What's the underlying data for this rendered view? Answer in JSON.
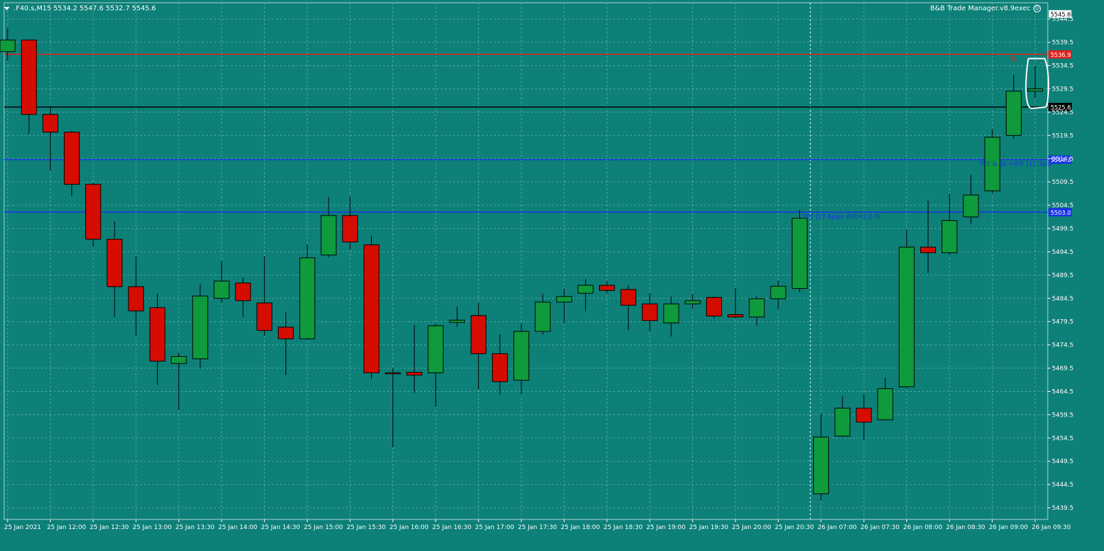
{
  "header": {
    "symbol_line": ".F40.s,M15  5534.2 5547.6 5532.7 5545.6",
    "expert_advisor": "B&B Trade Manager.v8.9exec"
  },
  "colors": {
    "background": "#0d8078",
    "bull": "#0f9a3c",
    "bear": "#d40d00",
    "grid": "#6fb8b2",
    "axis_text": "#ffffff",
    "sl_line": "#e0201c",
    "tp_line": "#1830e8",
    "price_line": "#000000"
  },
  "chart_data": {
    "type": "candlestick",
    "symbol": ".F40.s",
    "timeframe": "M15",
    "ylim": [
      5437.0,
      5548.0
    ],
    "y_ticks": [
      "5544.5",
      "5539.5",
      "5534.5",
      "5529.5",
      "5524.5",
      "5519.5",
      "5514.5",
      "5509.5",
      "5504.5",
      "5499.5",
      "5494.5",
      "5489.5",
      "5484.5",
      "5479.5",
      "5474.5",
      "5469.5",
      "5464.5",
      "5459.5",
      "5454.5",
      "5449.5",
      "5444.5",
      "5439.5"
    ],
    "x_labels": [
      "25 Jan 2021",
      "25 Jan 12:00",
      "25 Jan 12:30",
      "25 Jan 13:00",
      "25 Jan 13:30",
      "25 Jan 14:00",
      "25 Jan 14:30",
      "25 Jan 15:00",
      "25 Jan 15:30",
      "25 Jan 16:00",
      "25 Jan 16:30",
      "25 Jan 17:00",
      "25 Jan 17:30",
      "25 Jan 18:00",
      "25 Jan 18:30",
      "25 Jan 19:00",
      "25 Jan 19:30",
      "25 Jan 20:00",
      "25 Jan 20:30",
      "26 Jan 07:00",
      "26 Jan 07:30",
      "26 Jan 08:00",
      "26 Jan 08:30",
      "26 Jan 09:00",
      "26 Jan 09:30"
    ],
    "candles": [
      {
        "o": 5537.5,
        "h": 5542.6,
        "l": 5535.5,
        "c": 5540.0
      },
      {
        "o": 5540.0,
        "h": 5540.0,
        "l": 5519.8,
        "c": 5524.0
      },
      {
        "o": 5524.0,
        "h": 5525.8,
        "l": 5512.0,
        "c": 5520.2
      },
      {
        "o": 5520.2,
        "h": 5520.5,
        "l": 5506.5,
        "c": 5509.0
      },
      {
        "o": 5509.0,
        "h": 5509.3,
        "l": 5495.5,
        "c": 5497.2
      },
      {
        "o": 5497.2,
        "h": 5501.0,
        "l": 5480.5,
        "c": 5487.0
      },
      {
        "o": 5487.0,
        "h": 5493.5,
        "l": 5476.5,
        "c": 5481.8
      },
      {
        "o": 5482.5,
        "h": 5485.5,
        "l": 5466.0,
        "c": 5471.0
      },
      {
        "o": 5470.5,
        "h": 5472.8,
        "l": 5460.5,
        "c": 5472.0
      },
      {
        "o": 5471.5,
        "h": 5487.5,
        "l": 5469.5,
        "c": 5485.0
      },
      {
        "o": 5484.5,
        "h": 5492.5,
        "l": 5483.5,
        "c": 5488.2
      },
      {
        "o": 5487.8,
        "h": 5489.0,
        "l": 5480.5,
        "c": 5484.0
      },
      {
        "o": 5483.5,
        "h": 5493.5,
        "l": 5476.5,
        "c": 5477.6
      },
      {
        "o": 5478.3,
        "h": 5481.5,
        "l": 5468.0,
        "c": 5475.8
      },
      {
        "o": 5475.8,
        "h": 5496.0,
        "l": 5475.5,
        "c": 5493.2
      },
      {
        "o": 5493.8,
        "h": 5506.3,
        "l": 5493.3,
        "c": 5502.3
      },
      {
        "o": 5502.3,
        "h": 5506.3,
        "l": 5495.0,
        "c": 5496.6
      },
      {
        "o": 5496.0,
        "h": 5498.0,
        "l": 5467.3,
        "c": 5468.5
      },
      {
        "o": 5468.5,
        "h": 5469.5,
        "l": 5452.5,
        "c": 5468.3
      },
      {
        "o": 5468.6,
        "h": 5478.8,
        "l": 5464.2,
        "c": 5468.0
      },
      {
        "o": 5468.5,
        "h": 5479.0,
        "l": 5461.2,
        "c": 5478.6
      },
      {
        "o": 5479.3,
        "h": 5482.7,
        "l": 5478.4,
        "c": 5479.8
      },
      {
        "o": 5480.8,
        "h": 5483.5,
        "l": 5465.0,
        "c": 5472.6
      },
      {
        "o": 5472.6,
        "h": 5476.8,
        "l": 5463.8,
        "c": 5466.6
      },
      {
        "o": 5466.9,
        "h": 5479.0,
        "l": 5463.8,
        "c": 5477.4
      },
      {
        "o": 5477.4,
        "h": 5485.5,
        "l": 5476.7,
        "c": 5483.7
      },
      {
        "o": 5483.7,
        "h": 5486.6,
        "l": 5479.2,
        "c": 5484.9
      },
      {
        "o": 5485.6,
        "h": 5488.6,
        "l": 5481.7,
        "c": 5487.3
      },
      {
        "o": 5487.3,
        "h": 5488.2,
        "l": 5485.6,
        "c": 5486.2
      },
      {
        "o": 5486.4,
        "h": 5487.4,
        "l": 5477.7,
        "c": 5483.0
      },
      {
        "o": 5483.3,
        "h": 5485.6,
        "l": 5477.5,
        "c": 5479.7
      },
      {
        "o": 5479.2,
        "h": 5484.9,
        "l": 5476.3,
        "c": 5483.3
      },
      {
        "o": 5483.3,
        "h": 5485.4,
        "l": 5482.3,
        "c": 5484.0
      },
      {
        "o": 5484.7,
        "h": 5485.0,
        "l": 5480.2,
        "c": 5480.7
      },
      {
        "o": 5481.0,
        "h": 5486.7,
        "l": 5480.2,
        "c": 5480.5
      },
      {
        "o": 5480.5,
        "h": 5484.9,
        "l": 5478.6,
        "c": 5484.4
      },
      {
        "o": 5484.4,
        "h": 5488.3,
        "l": 5482.2,
        "c": 5487.1
      },
      {
        "o": 5486.6,
        "h": 5503.5,
        "l": 5485.8,
        "c": 5501.7
      },
      {
        "o": 5442.5,
        "h": 5459.8,
        "l": 5441.0,
        "c": 5454.7
      },
      {
        "o": 5454.9,
        "h": 5463.5,
        "l": 5454.8,
        "c": 5460.9
      },
      {
        "o": 5460.9,
        "h": 5463.9,
        "l": 5454.0,
        "c": 5457.9
      },
      {
        "o": 5458.4,
        "h": 5467.4,
        "l": 5458.2,
        "c": 5465.1
      },
      {
        "o": 5465.5,
        "h": 5499.3,
        "l": 5465.2,
        "c": 5495.5
      },
      {
        "o": 5495.5,
        "h": 5505.5,
        "l": 5490.0,
        "c": 5494.3
      },
      {
        "o": 5494.3,
        "h": 5507.0,
        "l": 5493.8,
        "c": 5501.2
      },
      {
        "o": 5502.0,
        "h": 5511.0,
        "l": 5500.5,
        "c": 5506.7
      },
      {
        "o": 5507.6,
        "h": 5520.8,
        "l": 5507.0,
        "c": 5519.1
      },
      {
        "o": 5519.5,
        "h": 5532.5,
        "l": 5518.8,
        "c": 5529.0
      },
      {
        "o": 5529.0,
        "h": 5534.5,
        "l": 5527.5,
        "c": 5529.5
      }
    ],
    "levels": [
      {
        "name": "sl",
        "price": 5536.9,
        "label": "5536.9",
        "note": "SL"
      },
      {
        "name": "current",
        "price": 5525.6,
        "label": "5525.6",
        "note": ""
      },
      {
        "name": "tp1",
        "price": 5514.3,
        "label": "5514.3",
        "note": "TP1 & SL->B/E (11.3pip"
      },
      {
        "name": "tp2",
        "price": 5503.0,
        "label": "5503.0",
        "note": "TP2 (22.6pips R/R=1:2.0)"
      }
    ],
    "price_label": "5545.6",
    "grid": true
  }
}
